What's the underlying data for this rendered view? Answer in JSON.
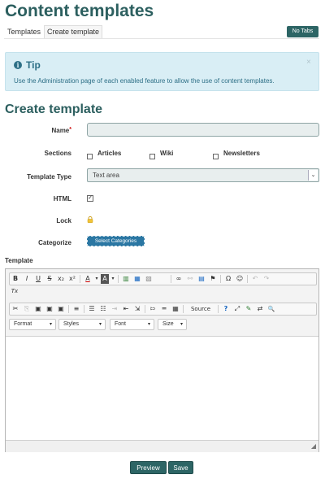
{
  "page": {
    "title": "Content templates",
    "tabs": [
      {
        "label": "Templates",
        "active": false
      },
      {
        "label": "Create template",
        "active": true
      }
    ],
    "no_tabs_label": "No Tabs"
  },
  "tip": {
    "title": "Tip",
    "text": "Use the Administration page of each enabled feature to allow the use of content templates.",
    "close": "×"
  },
  "form": {
    "section_title": "Create template",
    "name_label": "Name",
    "name_required": "*",
    "name_value": "",
    "sections_label": "Sections",
    "sections": [
      {
        "label": "Articles",
        "checked": false
      },
      {
        "label": "Wiki",
        "checked": false
      },
      {
        "label": "Newsletters",
        "checked": false
      }
    ],
    "type_label": "Template Type",
    "type_value": "Text area",
    "html_label": "HTML",
    "html_checked": true,
    "lock_label": "Lock",
    "categorize_label": "Categorize",
    "categorize_button": "Select Categories",
    "template_label": "Template"
  },
  "editor": {
    "row1": [
      "B",
      "I",
      "U",
      "S",
      "x₂",
      "x²",
      "|",
      "A",
      "▾",
      "A",
      "▾",
      "|",
      "▥",
      "▦",
      "▧",
      "|",
      "∞",
      "⚯",
      "▤",
      "⚑",
      "|",
      "Ω",
      "☺",
      "|",
      "↶",
      "↷"
    ],
    "row1b": [
      "Tx"
    ],
    "row2": [
      "✂",
      "⎘",
      "▣",
      "▣",
      "▣",
      "|",
      "≡",
      "|",
      "☰",
      "☷",
      "⇥",
      "⇤",
      "⇲",
      "|",
      "⇰",
      "═",
      "▦",
      "|",
      "Source",
      "|",
      "?",
      "⤢",
      "✎",
      "⇄",
      "🔍"
    ],
    "combos": [
      "Format",
      "Styles",
      "Font",
      "Size"
    ],
    "content": ""
  },
  "actions": {
    "preview": "Preview",
    "save": "Save"
  },
  "colors": {
    "heading": "#2c5f5f",
    "button": "#2d6565",
    "tip_bg": "#d9eef5",
    "tip_text": "#2d6f86",
    "category_button": "#2b77a3"
  }
}
